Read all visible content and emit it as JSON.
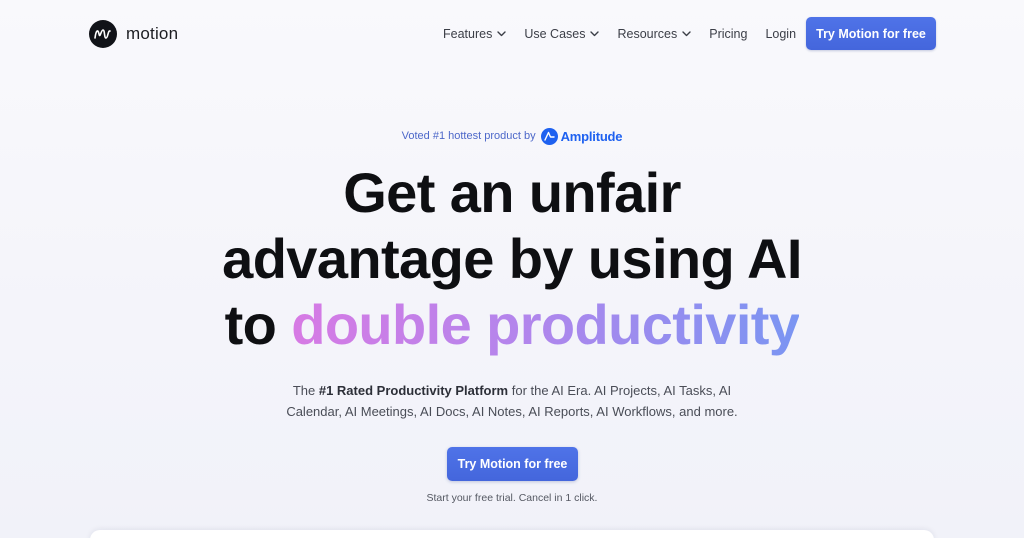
{
  "brand": {
    "name": "motion",
    "logo_icon": "motion-m-logo-icon"
  },
  "nav": {
    "items": [
      {
        "label": "Features",
        "has_dropdown": true
      },
      {
        "label": "Use Cases",
        "has_dropdown": true
      },
      {
        "label": "Resources",
        "has_dropdown": true
      },
      {
        "label": "Pricing",
        "has_dropdown": false
      },
      {
        "label": "Login",
        "has_dropdown": false
      }
    ],
    "cta_label": "Try Motion for free"
  },
  "hero": {
    "voted_text": "Voted #1 hottest product by",
    "voted_brand": "Amplitude",
    "headline_line1": "Get an unfair",
    "headline_line2": "advantage by using AI",
    "headline_line3_plain": "to ",
    "headline_line3_gradient": "double productivity",
    "sub_prefix": "The ",
    "sub_bold": "#1 Rated Productivity Platform",
    "sub_line1_rest": " for the AI Era. AI Projects, AI Tasks, AI",
    "sub_line2": "Calendar, AI Meetings, AI Docs, AI Notes, AI Reports, AI Workflows, and more.",
    "cta_label": "Try Motion for free",
    "trial_note": "Start your free trial. Cancel in 1 click."
  },
  "colors": {
    "accent": "#4a6ce2",
    "amplitude_blue": "#1e61f0",
    "gradient_start": "#d77ae4",
    "gradient_end": "#7a95f2",
    "headline": "#0e0f12"
  }
}
